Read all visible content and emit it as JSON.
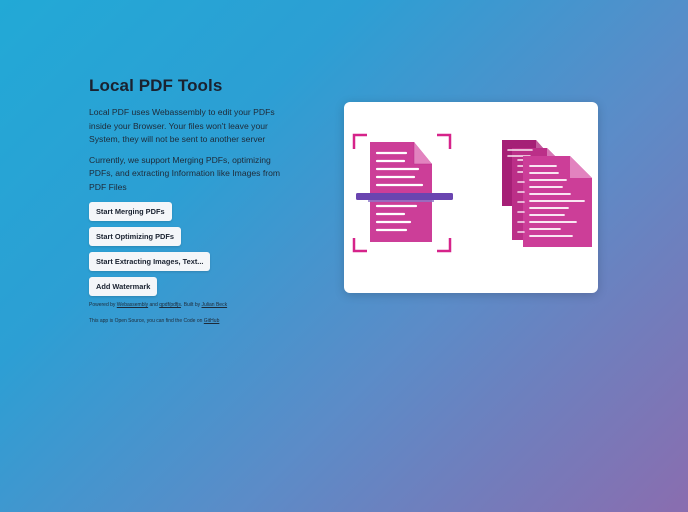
{
  "title": "Local PDF Tools",
  "intro": "Local PDF uses Webassembly to edit your PDFs inside your Browser. Your files won't leave your System, they will not be sent to another server",
  "support": "Currently, we support Merging PDFs, optimizing PDFs, and extracting Information like Images from PDF Files",
  "buttons": {
    "merge": "Start Merging PDFs",
    "optimize": "Start Optimizing PDFs",
    "extract": "Start Extracting Images, Text...",
    "watermark": "Add Watermark"
  },
  "footer": {
    "powered_prefix": "Powered by",
    "webassembly": "Webassembly",
    "and": "and",
    "qpdf": "qpdf/pdfjs",
    "built_by": ". Built by",
    "author": "Julian Beck",
    "open_source": "This app is Open Source, you can find the Code on",
    "github": "GitHub"
  },
  "illustration": {
    "left_icon": "scan-document-icon",
    "right_icon": "stacked-documents-icon",
    "colors": {
      "doc": "#cc3e98",
      "doc_fold": "#e283bf",
      "doc_back": "#a51f76",
      "corners": "#d6238a",
      "scan_bar": "#6a45b0"
    }
  }
}
